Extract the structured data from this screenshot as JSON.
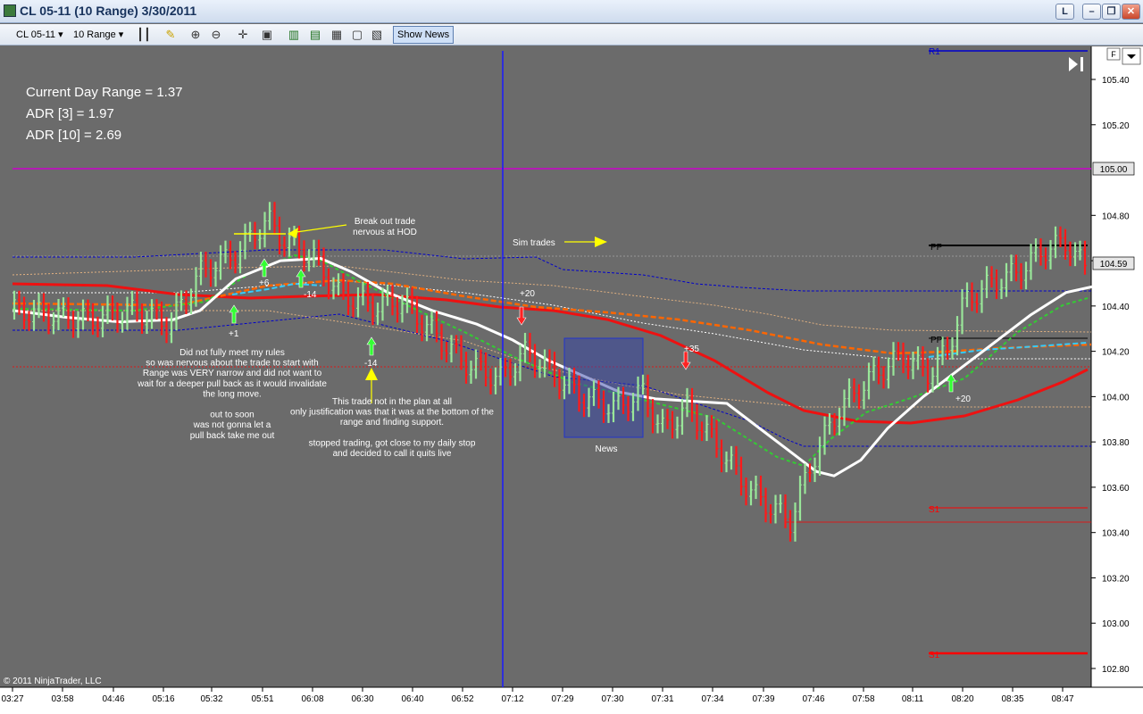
{
  "window": {
    "title": "CL 05-11 (10 Range)  3/30/2011",
    "btn_l": "L"
  },
  "toolbar": {
    "instrument": "CL 05-11",
    "period": "10 Range",
    "show_news": "Show News"
  },
  "stats": {
    "current_day_range": "Current Day Range = 1.37",
    "adr3": "ADR [3] = 1.97",
    "adr10": "ADR [10] = 2.69"
  },
  "copyright": "© 2011 NinjaTrader, LLC",
  "price_markers": {
    "level_105": "105.00",
    "last": "104.59"
  },
  "chart_controls": {
    "f_button": "F"
  },
  "pivot_labels": {
    "r1": "R1",
    "pp": "PP",
    "pp2": "PP",
    "s1": "S1",
    "s1b": "S1"
  },
  "annotations": {
    "breakout": [
      "Break out trade",
      "nervous at HOD"
    ],
    "sim": "Sim trades",
    "note1": [
      "Did not fully meet my rules",
      "so was nervous about the trade to start with",
      "Range was VERY narrow and did not want to",
      "wait for a deeper pull back as it would invalidate",
      "the long move.",
      "",
      "out to soon",
      "was not gonna let a",
      "pull back take me out"
    ],
    "note2": [
      "This trade not in the plan at all",
      "only justification was that it was at the bottom of the",
      "range and finding support.",
      "",
      "stopped trading, got close to my daily stop",
      "and decided to call it quits live"
    ],
    "news": "News"
  },
  "trade_labels": {
    "t1": "+6",
    "t2": "-14",
    "t3": "+1",
    "t4": "-14",
    "t5": "+20",
    "t6": "+35",
    "t7": "+20"
  },
  "colors": {
    "bull": "#99e699",
    "bear": "#ff1a1a",
    "sma": "#ffffff",
    "cyan": "#33ccff",
    "green_dash": "#33cc33",
    "orange_dash": "#ff6600",
    "pivot_red": "#ff0000",
    "r1_blue": "#0000cc",
    "purple": "#cc00cc",
    "plot_bg": "#6b6b6b"
  },
  "chart_data": {
    "type": "bar",
    "y_axis": {
      "ticks": [
        "105.40",
        "105.20",
        "104.80",
        "104.60",
        "104.40",
        "104.20",
        "104.00",
        "103.80",
        "103.60",
        "103.40",
        "103.20",
        "103.00",
        "102.80"
      ],
      "ylim": [
        102.74,
        105.53
      ]
    },
    "x_axis": {
      "ticks": [
        "03:27",
        "03:58",
        "04:46",
        "05:16",
        "05:32",
        "05:51",
        "06:08",
        "06:30",
        "06:40",
        "06:52",
        "07:12",
        "07:29",
        "07:30",
        "07:31",
        "07:34",
        "07:39",
        "07:46",
        "07:58",
        "08:11",
        "08:20",
        "08:35",
        "08:47"
      ]
    },
    "levels": {
      "r1": 105.53,
      "purple": 105.0,
      "pp": 104.67,
      "pp2": 104.28,
      "s1": 103.51,
      "s1b": 102.87
    },
    "sma_series": [
      [
        0,
        104.38
      ],
      [
        60,
        104.35
      ],
      [
        120,
        104.33
      ],
      [
        180,
        104.34
      ],
      [
        210,
        104.38
      ],
      [
        250,
        104.52
      ],
      [
        300,
        104.6
      ],
      [
        345,
        104.61
      ],
      [
        380,
        104.55
      ],
      [
        420,
        104.46
      ],
      [
        470,
        104.38
      ],
      [
        520,
        104.32
      ],
      [
        560,
        104.25
      ],
      [
        600,
        104.16
      ],
      [
        640,
        104.09
      ],
      [
        680,
        104.02
      ],
      [
        720,
        103.99
      ],
      [
        760,
        103.98
      ],
      [
        800,
        103.97
      ],
      [
        840,
        103.85
      ],
      [
        870,
        103.76
      ],
      [
        900,
        103.67
      ],
      [
        920,
        103.65
      ],
      [
        950,
        103.72
      ],
      [
        980,
        103.86
      ],
      [
        1020,
        104.0
      ],
      [
        1060,
        104.12
      ],
      [
        1100,
        104.24
      ],
      [
        1140,
        104.36
      ],
      [
        1180,
        104.46
      ],
      [
        1215,
        104.49
      ]
    ]
  }
}
